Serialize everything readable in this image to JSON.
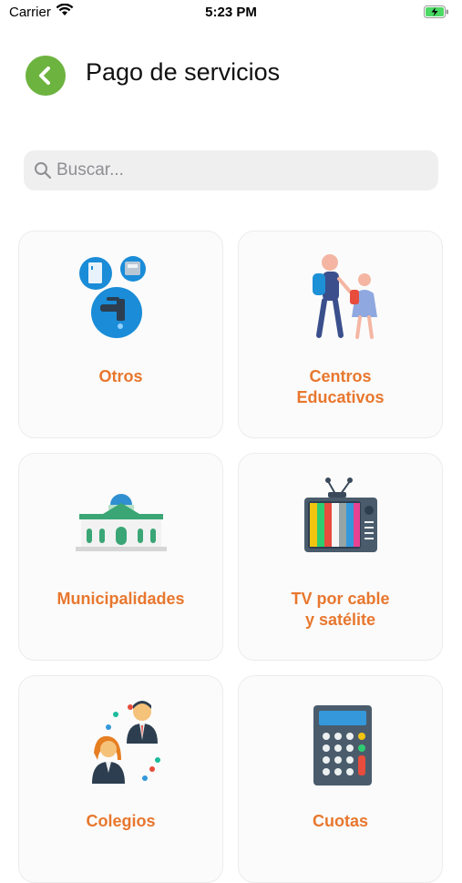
{
  "status_bar": {
    "carrier": "Carrier",
    "time": "5:23 PM"
  },
  "header": {
    "title": "Pago de servicios",
    "back_icon": "chevron-left-icon"
  },
  "search": {
    "placeholder": "Buscar...",
    "value": ""
  },
  "categories": [
    {
      "label": "Otros",
      "icon": "utilities-icon"
    },
    {
      "label": "Centros\nEducativos",
      "icon": "students-icon"
    },
    {
      "label": "Municipalidades",
      "icon": "municipal-building-icon"
    },
    {
      "label": "TV por cable\ny satélite",
      "icon": "tv-icon"
    },
    {
      "label": "Colegios",
      "icon": "professionals-icon"
    },
    {
      "label": "Cuotas",
      "icon": "calculator-icon"
    }
  ],
  "colors": {
    "accent": "#6db33f",
    "label": "#e8772e"
  }
}
